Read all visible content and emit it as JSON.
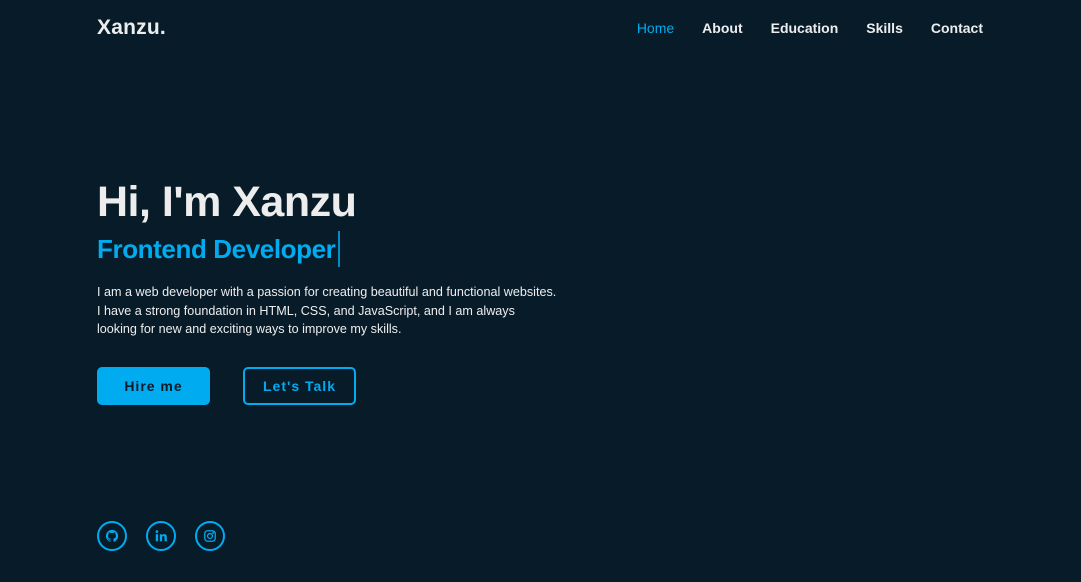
{
  "header": {
    "logo": "Xanzu.",
    "nav": [
      {
        "label": "Home",
        "active": true
      },
      {
        "label": "About",
        "active": false
      },
      {
        "label": "Education",
        "active": false
      },
      {
        "label": "Skills",
        "active": false
      },
      {
        "label": "Contact",
        "active": false
      }
    ]
  },
  "hero": {
    "greeting": "Hi, I'm Xanzu",
    "role": "Frontend Developer",
    "bio": "I am a web developer with a passion for creating beautiful and functional websites. I have a strong foundation in HTML, CSS, and JavaScript, and I am always looking for new and exciting ways to improve my skills.",
    "primary_button": "Hire me",
    "secondary_button": "Let's Talk"
  },
  "social": {
    "icons": [
      "github-icon",
      "linkedin-icon",
      "instagram-icon"
    ]
  },
  "colors": {
    "background": "#081b29",
    "accent": "#00abf0",
    "text": "#ededed"
  }
}
